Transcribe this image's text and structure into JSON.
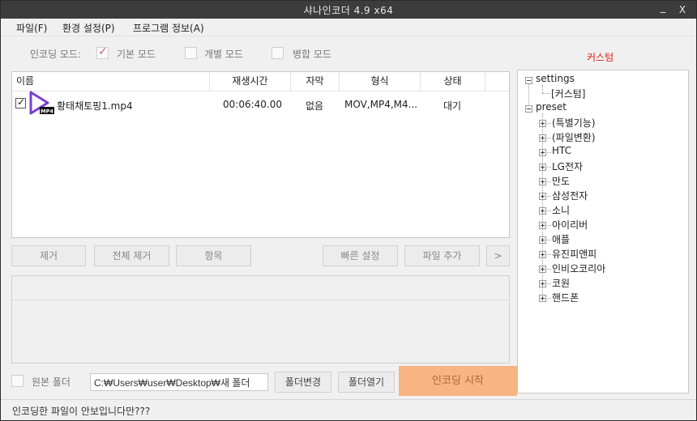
{
  "titlebar": {
    "title": "샤나인코더 4.9 x64",
    "minimize": "_",
    "close": "X"
  },
  "menu": [
    "파일(F)",
    "환경 설정(P)",
    "프로그램 정보(A)"
  ],
  "modes": {
    "label": "인코딩 모드:",
    "basic": "기본 모드",
    "individual": "개별 모드",
    "merge": "병합 모드"
  },
  "custom_label": "커스텀",
  "filelist": {
    "columns": [
      "이름",
      "재생시간",
      "자막",
      "형식",
      "상태"
    ],
    "rows": [
      {
        "name": "황태채토핑1.mp4",
        "duration": "00:06:40.00",
        "subtitle": "없음",
        "format": "MOV,MP4,M4...",
        "status": "대기",
        "icon_badge": "MP4"
      }
    ]
  },
  "buttons": {
    "remove": "제거",
    "remove_all": "전체 제거",
    "items": "항목",
    "quick_settings": "빠른 설정",
    "add_file": "파일 추가",
    "more": ">",
    "change_folder": "폴더변경",
    "open_folder": "폴더열기",
    "start_encoding": "인코딩 시작"
  },
  "output": {
    "source_folder_label": "원본 폴더",
    "path": "C:₩Users₩user₩Desktop₩새 폴더"
  },
  "tree": {
    "settings": "settings",
    "custom": "[커스텀]",
    "preset": "preset",
    "presets": [
      "(특별기능)",
      "(파일변환)",
      "HTC",
      "LG전자",
      "만도",
      "삼성전자",
      "소니",
      "아이리버",
      "애플",
      "유진피앤피",
      "인비오코리아",
      "코원",
      "핸드폰"
    ]
  },
  "status": "인코딩한 파일이 안보입니다만???",
  "colors": {
    "titlebar": "#3c3c3c",
    "accent": "#f8b482",
    "custom_red": "#e02020",
    "play_icon": "#7b3fd6"
  }
}
